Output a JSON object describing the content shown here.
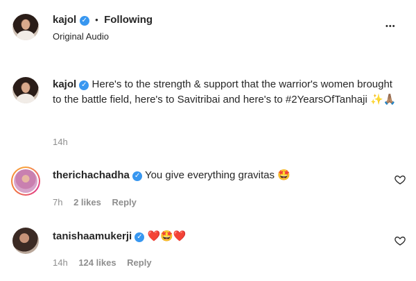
{
  "header": {
    "username": "kajol",
    "separator": "•",
    "follow_status": "Following",
    "audio": "Original Audio",
    "more": "•••"
  },
  "post": {
    "username": "kajol",
    "caption": "Here's to the strength & support that the warrior's women brought to the battle field, here's to Savitribai and here's to #2YearsOfTanhaji ✨🙏🏽",
    "time": "14h"
  },
  "comments": [
    {
      "username": "therichachadha",
      "text": "You give everything gravitas 🤩",
      "time": "7h",
      "likes": "2 likes",
      "reply": "Reply"
    },
    {
      "username": "tanishaamukerji",
      "text": "❤️🤩❤️",
      "time": "14h",
      "likes": "124 likes",
      "reply": "Reply"
    }
  ],
  "colors": {
    "verified": "#3897f0",
    "text": "#262626",
    "muted": "#8e8e8e"
  },
  "icons": {
    "verified": "verified-badge-icon",
    "like": "heart-outline-icon",
    "more": "more-options-icon"
  }
}
